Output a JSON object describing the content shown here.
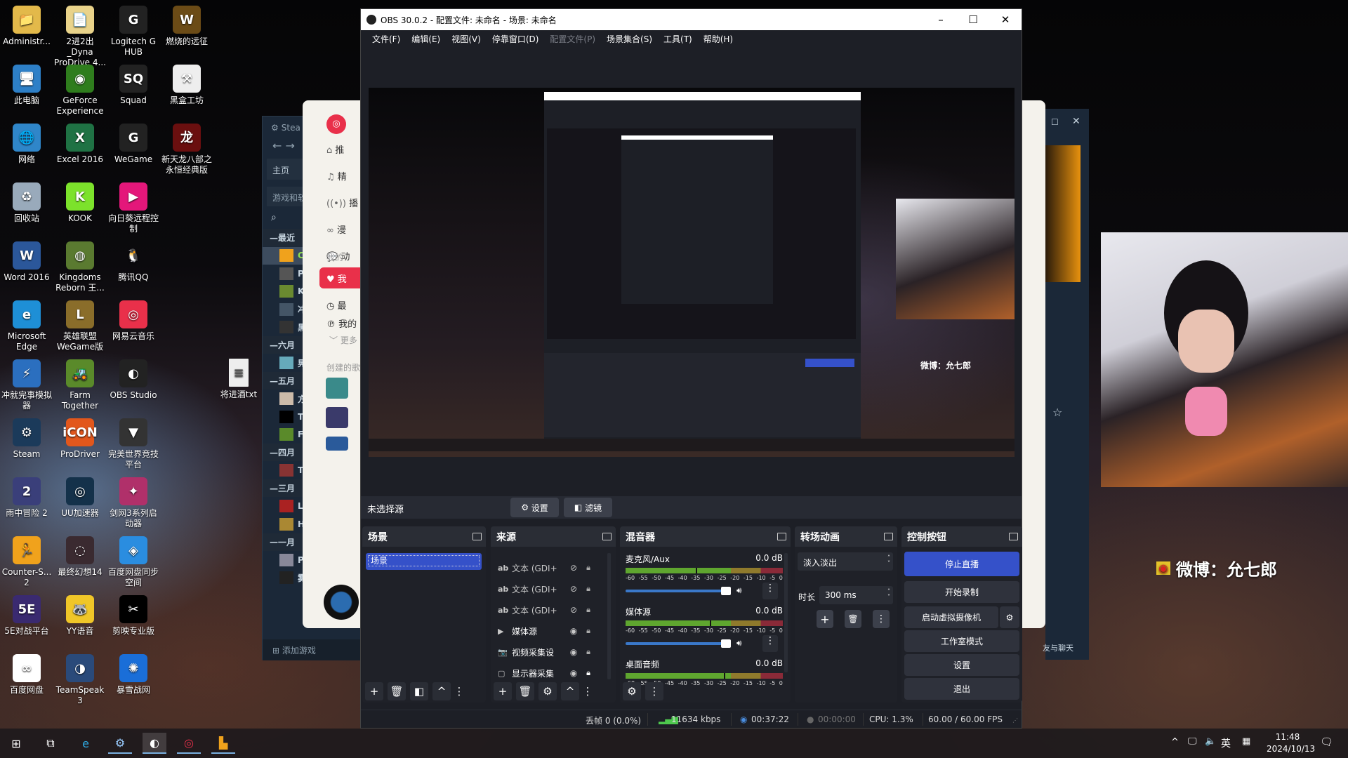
{
  "desktop": {
    "icons": [
      {
        "label": "Administr...",
        "glyph": "📁",
        "color": "#e3b94a"
      },
      {
        "label": "2进2出_Dyna ProDrive 4...",
        "glyph": "📄",
        "color": "#e9d38a"
      },
      {
        "label": "Logitech G HUB",
        "glyph": "G",
        "color": "#222"
      },
      {
        "label": "燃烧的远征",
        "glyph": "W",
        "color": "#6b4b16"
      },
      {
        "label": "此电脑",
        "glyph": "🖥",
        "color": "#2d7fc7"
      },
      {
        "label": "GeForce Experience",
        "glyph": "◉",
        "color": "#2f7d1d"
      },
      {
        "label": "Squad",
        "glyph": "SQ",
        "color": "#222"
      },
      {
        "label": "黑盒工坊",
        "glyph": "⚒",
        "color": "#eee"
      },
      {
        "label": "网络",
        "glyph": "🌐",
        "color": "#2f86c9"
      },
      {
        "label": "Excel 2016",
        "glyph": "X",
        "color": "#1f7244"
      },
      {
        "label": "WeGame",
        "glyph": "G",
        "color": "#222"
      },
      {
        "label": "新天龙八部之永恒经典版",
        "glyph": "龙",
        "color": "#6a0f0f"
      },
      {
        "label": "回收站",
        "glyph": "♻",
        "color": "#9ab"
      },
      {
        "label": "KOOK",
        "glyph": "K",
        "color": "#7ce22b"
      },
      {
        "label": "向日葵远程控制",
        "glyph": "▶",
        "color": "#e4177a"
      },
      {
        "label": "",
        "glyph": "",
        "color": "transparent"
      },
      {
        "label": "Word 2016",
        "glyph": "W",
        "color": "#2b579a"
      },
      {
        "label": "Kingdoms Reborn 王...",
        "glyph": "◍",
        "color": "#5a7a30"
      },
      {
        "label": "腾讯QQ",
        "glyph": "🐧",
        "color": "transparent"
      },
      {
        "label": "",
        "glyph": "",
        "color": "transparent"
      },
      {
        "label": "Microsoft Edge",
        "glyph": "e",
        "color": "#1e8fd6"
      },
      {
        "label": "英雄联盟WeGame版",
        "glyph": "L",
        "color": "#8a6d2a"
      },
      {
        "label": "网易云音乐",
        "glyph": "◎",
        "color": "#e9304a"
      },
      {
        "label": "",
        "glyph": "",
        "color": "transparent"
      },
      {
        "label": "冲就完事模拟器",
        "glyph": "⚡",
        "color": "#2b6fbf"
      },
      {
        "label": "Farm Together",
        "glyph": "🚜",
        "color": "#5a8a2a"
      },
      {
        "label": "OBS Studio",
        "glyph": "◐",
        "color": "#222"
      },
      {
        "label": "",
        "glyph": "",
        "color": "transparent"
      },
      {
        "label": "Steam",
        "glyph": "⚙",
        "color": "#1b3a5a"
      },
      {
        "label": "ProDriver",
        "glyph": "iCON",
        "color": "#e2571c"
      },
      {
        "label": "完美世界竞技平台",
        "glyph": "▼",
        "color": "#333"
      },
      {
        "label": "",
        "glyph": "",
        "color": "transparent"
      },
      {
        "label": "雨中冒险 2",
        "glyph": "2",
        "color": "#3a3f7a"
      },
      {
        "label": "UU加速器",
        "glyph": "◎",
        "color": "#14314a"
      },
      {
        "label": "剑网3系列启动器",
        "glyph": "✦",
        "color": "#b0306a"
      },
      {
        "label": "",
        "glyph": "",
        "color": "transparent"
      },
      {
        "label": "Counter-S... 2",
        "glyph": "🏃",
        "color": "#f0a21c"
      },
      {
        "label": "最终幻想14",
        "glyph": "◌",
        "color": "#3a2a30"
      },
      {
        "label": "百度网盘同步空间",
        "glyph": "◈",
        "color": "#2a8de0"
      },
      {
        "label": "",
        "glyph": "",
        "color": "transparent"
      },
      {
        "label": "5E对战平台",
        "glyph": "5E",
        "color": "#3a2a70"
      },
      {
        "label": "YY语音",
        "glyph": "🦝",
        "color": "#f0c628"
      },
      {
        "label": "剪映专业版",
        "glyph": "✂",
        "color": "#000"
      },
      {
        "label": "",
        "glyph": "",
        "color": "transparent"
      },
      {
        "label": "百度网盘",
        "glyph": "∞",
        "color": "#fff"
      },
      {
        "label": "TeamSpeak 3",
        "glyph": "◑",
        "color": "#2a4a7a"
      },
      {
        "label": "暴雪战网",
        "glyph": "✺",
        "color": "#1a6ed8"
      }
    ],
    "file": {
      "label": "将进酒txt",
      "glyph": "📄"
    }
  },
  "steam_left": {
    "title": "Stea",
    "home": "主页",
    "library": "游戏和软",
    "items": [
      {
        "t": "group",
        "label": "最近"
      },
      {
        "t": "game",
        "label": "Co",
        "color": "#f0a21c",
        "active": true
      },
      {
        "t": "game",
        "label": "PU",
        "color": "#555"
      },
      {
        "t": "game",
        "label": "Ki",
        "color": "#6a8a30"
      },
      {
        "t": "game",
        "label": "冲",
        "color": "#456"
      },
      {
        "t": "game",
        "label": "黑",
        "color": "#333"
      },
      {
        "t": "group",
        "label": "六月"
      },
      {
        "t": "game",
        "label": "晃",
        "color": "#6ab"
      },
      {
        "t": "group",
        "label": "五月"
      },
      {
        "t": "game",
        "label": "方",
        "color": "#cba"
      },
      {
        "t": "game",
        "label": "Ta",
        "color": "#000"
      },
      {
        "t": "game",
        "label": "Fa",
        "color": "#5a8a2a"
      },
      {
        "t": "group",
        "label": "四月"
      },
      {
        "t": "game",
        "label": "Th",
        "color": "#833"
      },
      {
        "t": "group",
        "label": "三月"
      },
      {
        "t": "game",
        "label": "Le",
        "color": "#a22"
      },
      {
        "t": "game",
        "label": "HI",
        "color": "#a83"
      },
      {
        "t": "group",
        "label": "一月"
      },
      {
        "t": "game",
        "label": "Pa",
        "color": "#889"
      },
      {
        "t": "game",
        "label": "雾",
        "color": "#222"
      }
    ],
    "add_game": "添加游戏"
  },
  "netease": {
    "items": [
      "推",
      "精",
      "播",
      "漫",
      "动"
    ],
    "my_label": "我的",
    "liked": "我",
    "recent": "最",
    "mine": "我的",
    "more": "更多",
    "created": "创建的歌"
  },
  "steam_right": {
    "friends": "友与聊天"
  },
  "webcam_overlay": {
    "weibo_text": "微博：允七郎"
  },
  "obs": {
    "title": "OBS 30.0.2 - 配置文件: 未命名 - 场景: 未命名",
    "window_controls": [
      "–",
      "☐",
      "✕"
    ],
    "menu": [
      {
        "label": "文件(F)"
      },
      {
        "label": "编辑(E)"
      },
      {
        "label": "视图(V)"
      },
      {
        "label": "停靠窗口(D)"
      },
      {
        "label": "配置文件(P)",
        "disabled": true
      },
      {
        "label": "场景集合(S)"
      },
      {
        "label": "工具(T)"
      },
      {
        "label": "帮助(H)"
      }
    ],
    "preview_overlay_text": "微博：允七郎",
    "source_bar": {
      "no_source": "未选择源",
      "properties": "设置",
      "filters": "滤镜"
    },
    "scenes": {
      "title": "场景",
      "items": [
        {
          "label": "场景",
          "selected": true
        }
      ]
    },
    "sources": {
      "title": "来源",
      "items": [
        {
          "icon": "text-icon",
          "glyph": "ab",
          "label": "文本 (GDI+",
          "visible": false,
          "locked": false
        },
        {
          "icon": "text-icon",
          "glyph": "ab",
          "label": "文本 (GDI+",
          "visible": false,
          "locked": false
        },
        {
          "icon": "text-icon",
          "glyph": "ab",
          "label": "文本 (GDI+",
          "visible": false,
          "locked": false
        },
        {
          "icon": "media-icon",
          "glyph": "▶",
          "label": "媒体源",
          "visible": true,
          "locked": false
        },
        {
          "icon": "camera-icon",
          "glyph": "📷",
          "label": "视频采集设",
          "visible": true,
          "locked": false
        },
        {
          "icon": "monitor-icon",
          "glyph": "▢",
          "label": "显示器采集",
          "visible": true,
          "locked": true
        }
      ]
    },
    "mixer": {
      "title": "混音器",
      "scale": [
        "-60",
        "-55",
        "-50",
        "-45",
        "-40",
        "-35",
        "-30",
        "-25",
        "-20",
        "-15",
        "-10",
        "-5",
        "0"
      ],
      "channels": [
        {
          "name": "麦克风/Aux",
          "db": "0.0 dB",
          "volume_pct": 100
        },
        {
          "name": "媒体源",
          "db": "0.0 dB",
          "volume_pct": 100
        },
        {
          "name": "桌面音频",
          "db": "0.0 dB",
          "volume_pct": 100
        }
      ]
    },
    "transitions": {
      "title": "转场动画",
      "selected": "淡入淡出",
      "duration_label": "时长",
      "duration": "300 ms"
    },
    "controls": {
      "title": "控制按钮",
      "stop_stream": "停止直播",
      "start_record": "开始录制",
      "virtual_cam": "启动虚拟摄像机",
      "studio_mode": "工作室模式",
      "settings": "设置",
      "exit": "退出"
    },
    "status": {
      "dropped": "丢帧 0 (0.0%)",
      "bitrate": "11634 kbps",
      "stream_time": "00:37:22",
      "record_time": "00:00:00",
      "cpu": "CPU: 1.3%",
      "fps": "60.00 / 60.00 FPS"
    },
    "colors": {
      "accent": "#3551c9",
      "bg": "#1d1f26",
      "dock": "#1f2128",
      "button": "#3c404b"
    }
  },
  "taskbar": {
    "apps": [
      "start-icon",
      "task-view-icon",
      "edge-icon",
      "steam-icon",
      "obs-icon",
      "netease-music-icon",
      "counter-strike-icon"
    ],
    "tray_ime": "英",
    "time": "11:48",
    "date": "2024/10/13"
  }
}
